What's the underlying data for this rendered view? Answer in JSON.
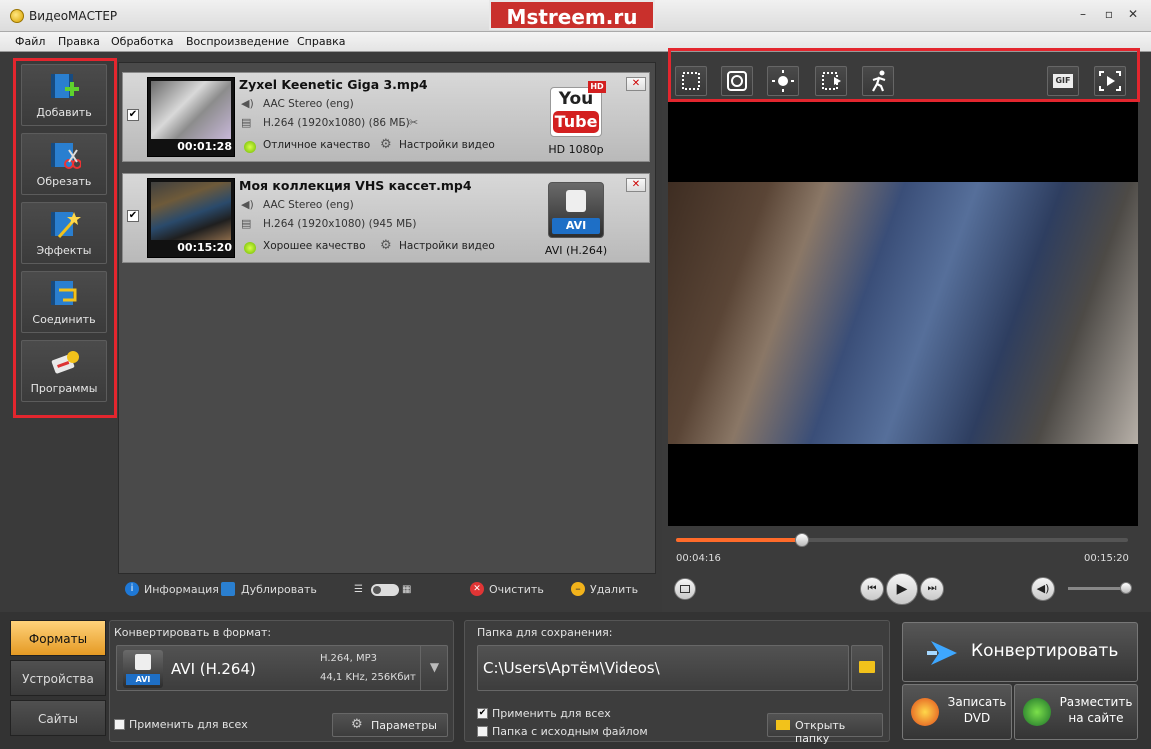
{
  "window": {
    "title": "ВидеоМАСТЕР",
    "watermark": "Mstreem.ru"
  },
  "menu": [
    "Файл",
    "Правка",
    "Обработка",
    "Воспроизведение",
    "Справка"
  ],
  "sidebar": [
    {
      "label": "Добавить",
      "icon": "film-add-icon"
    },
    {
      "label": "Обрезать",
      "icon": "film-scissors-icon"
    },
    {
      "label": "Эффекты",
      "icon": "magic-wand-icon"
    },
    {
      "label": "Соединить",
      "icon": "film-join-icon"
    },
    {
      "label": "Программы",
      "icon": "programs-key-icon"
    }
  ],
  "files": [
    {
      "name": "Zyxel Keenetic Giga 3.mp4",
      "audio": "AAC Stereo (eng)",
      "video": "H.264 (1920x1080) (86 МБ)",
      "duration": "00:01:28",
      "quality": "Отличное качество",
      "settings": "Настройки видео",
      "format_label": "HD 1080p",
      "format_logo_top": "You",
      "format_logo_bottom": "Tube",
      "format_badge": "HD",
      "checked": true
    },
    {
      "name": "Моя коллекция VHS кассет.mp4",
      "audio": "AAC Stereo (eng)",
      "video": "H.264 (1920x1080) (945 МБ)",
      "duration": "00:15:20",
      "quality": "Хорошее качество",
      "settings": "Настройки видео",
      "format_label": "AVI (H.264)",
      "format_badge": "AVI",
      "checked": true
    }
  ],
  "list_toolbar": {
    "info": "Информация",
    "duplicate": "Дублировать",
    "clear": "Очистить",
    "delete": "Удалить"
  },
  "player": {
    "current_time": "00:04:16",
    "total_time": "00:15:20",
    "progress": 0.278,
    "volume": 1.0
  },
  "tabs": [
    "Форматы",
    "Устройства",
    "Сайты"
  ],
  "format_panel": {
    "heading": "Конвертировать в формат:",
    "format_name": "AVI (H.264)",
    "badge": "AVI",
    "spec1": "H.264, MP3",
    "spec2": "44,1 KHz, 256Кбит",
    "apply_all": "Применить для всех",
    "params_button": "Параметры"
  },
  "folder_panel": {
    "heading": "Папка для сохранения:",
    "path": "C:\\Users\\Артём\\Videos\\",
    "apply_all": "Применить для всех",
    "apply_all_checked": true,
    "source_folder": "Папка с исходным файлом",
    "open_folder": "Открыть папку"
  },
  "actions": {
    "convert": "Конвертировать",
    "burn_dvd_line1": "Записать",
    "burn_dvd_line2": "DVD",
    "publish_line1": "Разместить",
    "publish_line2": "на сайте"
  },
  "colors": {
    "highlight": "#e3262e",
    "progress": "#ff6b2a",
    "active_tab": "#f2b34d"
  }
}
